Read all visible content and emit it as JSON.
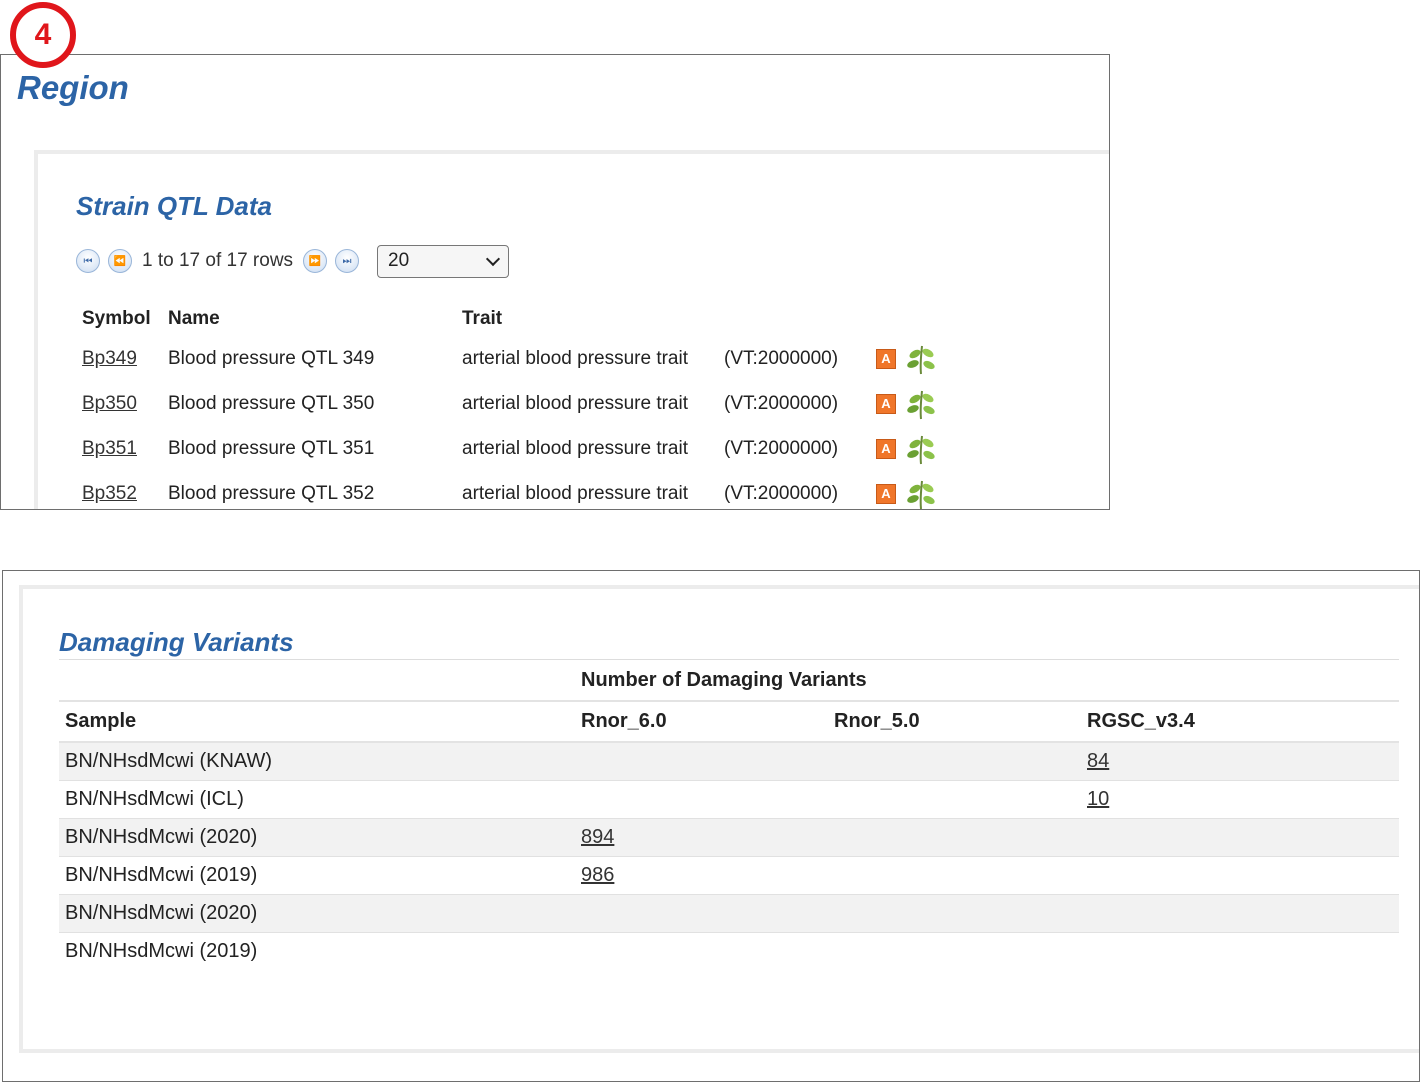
{
  "step_badge": "4",
  "region": {
    "title": "Region",
    "qtl": {
      "title": "Strain QTL Data",
      "pager_text": "1 to 17 of 17 rows",
      "rows_per_page": "20",
      "columns": [
        "Symbol",
        "Name",
        "Trait"
      ],
      "rows": [
        {
          "symbol": "Bp349",
          "name": "Blood pressure QTL 349",
          "trait": "arterial blood pressure trait",
          "vt": "(VT:2000000)"
        },
        {
          "symbol": "Bp350",
          "name": "Blood pressure QTL 350",
          "trait": "arterial blood pressure trait",
          "vt": "(VT:2000000)"
        },
        {
          "symbol": "Bp351",
          "name": "Blood pressure QTL 351",
          "trait": "arterial blood pressure trait",
          "vt": "(VT:2000000)"
        },
        {
          "symbol": "Bp352",
          "name": "Blood pressure QTL 352",
          "trait": "arterial blood pressure trait",
          "vt": "(VT:2000000)"
        }
      ],
      "annotation_icon_letter": "A"
    }
  },
  "damaging_variants": {
    "title": "Damaging Variants",
    "group_header": "Number of Damaging Variants",
    "columns": [
      "Sample",
      "Rnor_6.0",
      "Rnor_5.0",
      "RGSC_v3.4"
    ],
    "rows": [
      {
        "sample": "BN/NHsdMcwi (KNAW)",
        "rnor6": "",
        "rnor5": "",
        "rgsc": "84"
      },
      {
        "sample": "BN/NHsdMcwi (ICL)",
        "rnor6": "",
        "rnor5": "",
        "rgsc": "10"
      },
      {
        "sample": "BN/NHsdMcwi (2020)",
        "rnor6": "894",
        "rnor5": "",
        "rgsc": ""
      },
      {
        "sample": "BN/NHsdMcwi (2019)",
        "rnor6": "986",
        "rnor5": "",
        "rgsc": ""
      },
      {
        "sample": "BN/NHsdMcwi (2020)",
        "rnor6": "",
        "rnor5": "",
        "rgsc": ""
      },
      {
        "sample": "BN/NHsdMcwi (2019)",
        "rnor6": "",
        "rnor5": "",
        "rgsc": ""
      }
    ]
  }
}
